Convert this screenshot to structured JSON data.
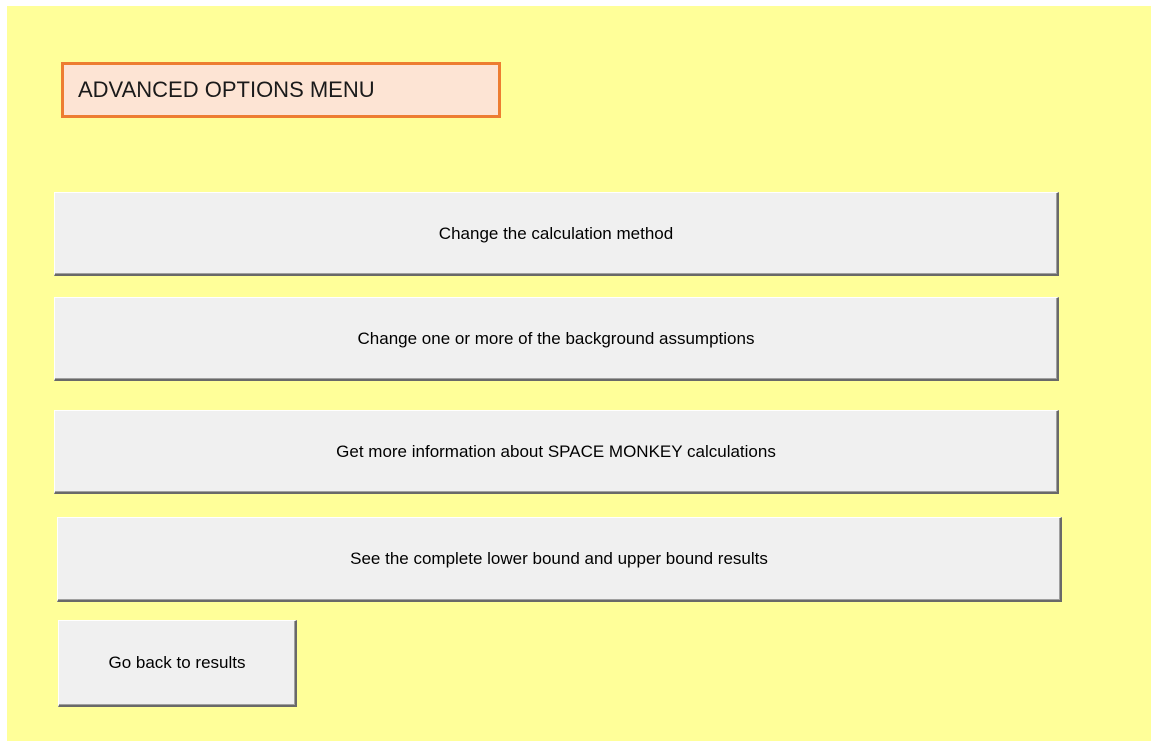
{
  "menu": {
    "title": "ADVANCED OPTIONS MENU"
  },
  "buttons": {
    "change_method": "Change the calculation method",
    "change_assumptions": "Change one or more of the background assumptions",
    "more_info": "Get more information about SPACE MONKEY calculations",
    "see_bounds": "See the complete lower bound and upper bound results",
    "go_back": "Go back to results"
  },
  "colors": {
    "panel_background": "#ffff99",
    "title_fill": "#fde4d4",
    "title_border": "#ed7d31",
    "button_face": "#f0f0f0"
  }
}
